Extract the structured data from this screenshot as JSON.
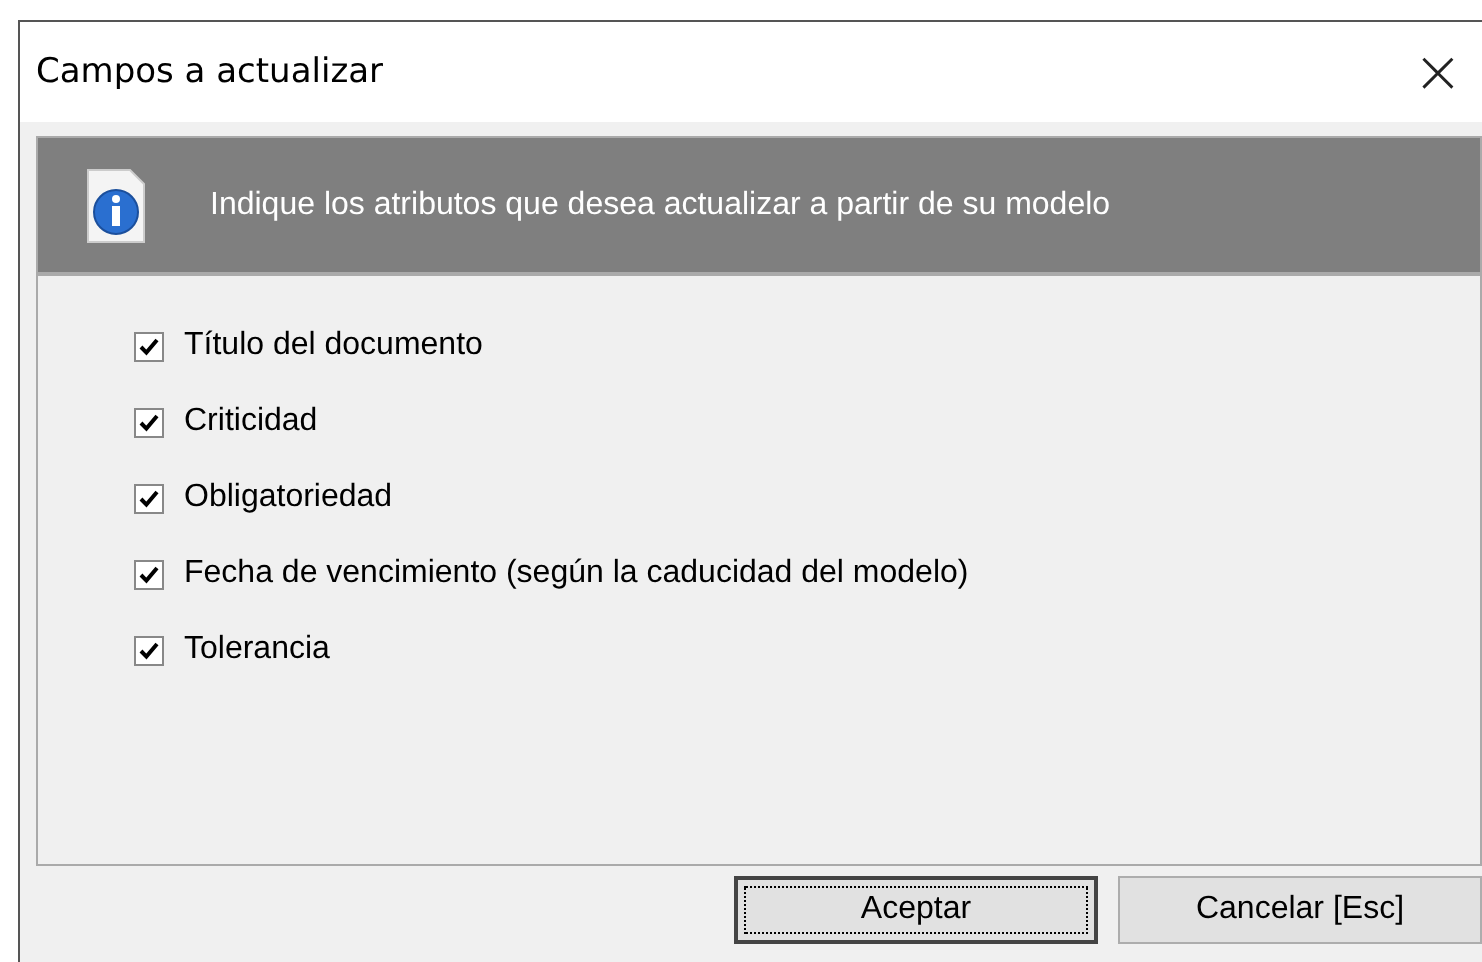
{
  "window": {
    "title": "Campos a actualizar",
    "close": "×"
  },
  "banner": {
    "text": "Indique los atributos que desea actualizar a partir de su modelo"
  },
  "fields": [
    {
      "label": "Título del documento",
      "checked": true
    },
    {
      "label": "Criticidad",
      "checked": true
    },
    {
      "label": "Obligatoriedad",
      "checked": true
    },
    {
      "label": "Fecha de vencimiento (según la caducidad del modelo)",
      "checked": true
    },
    {
      "label": "Tolerancia",
      "checked": true
    }
  ],
  "buttons": [
    {
      "label": "Aceptar",
      "focused": true
    },
    {
      "label": "Cancelar [Esc]",
      "focused": false
    }
  ]
}
